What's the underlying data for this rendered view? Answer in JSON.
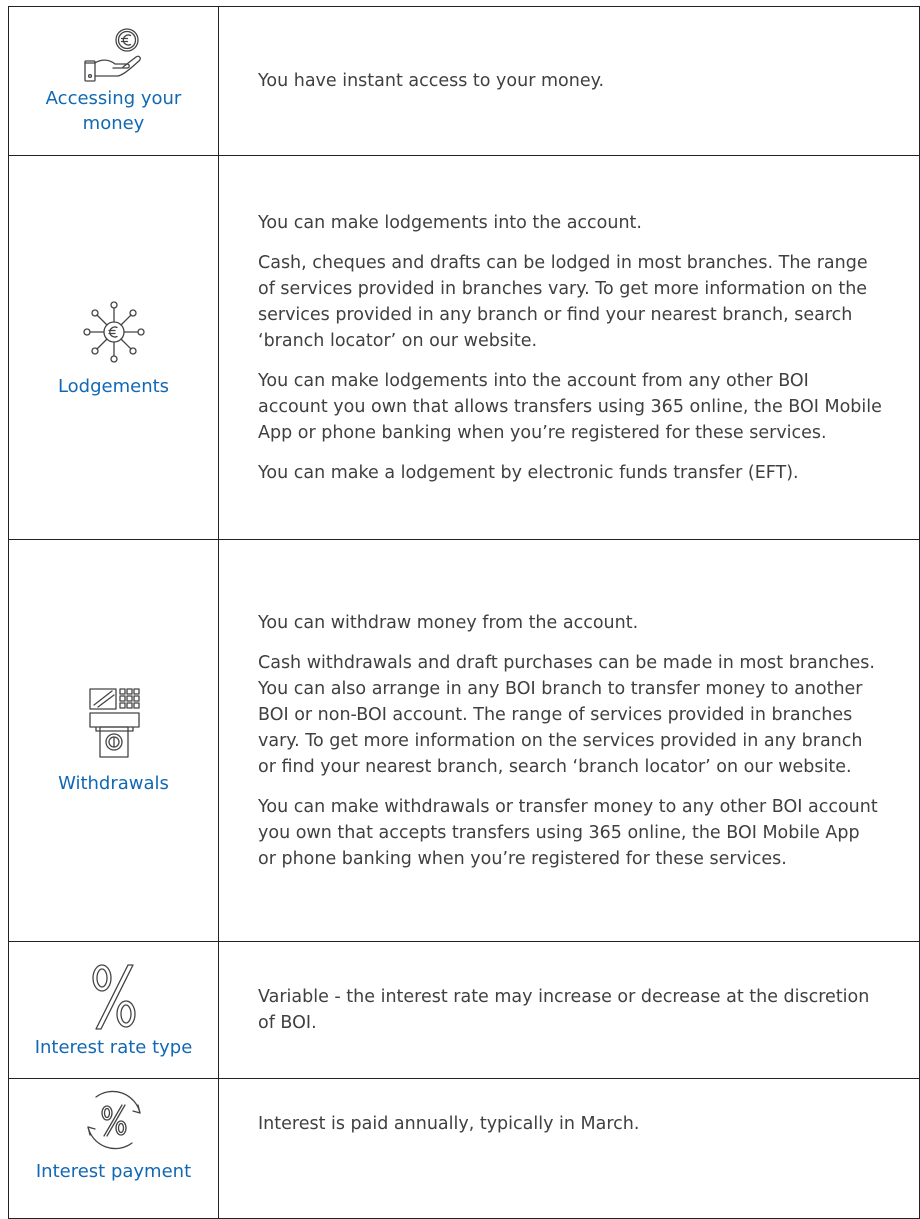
{
  "rows": [
    {
      "label": "Accessing your money",
      "icon": "hand-euro-icon",
      "paragraphs": [
        "You have instant access to your money."
      ]
    },
    {
      "label": "Lodgements",
      "icon": "euro-network-icon",
      "paragraphs": [
        "You can make lodgements into the account.",
        "Cash, cheques and drafts can be lodged in most branches. The range of services provided in branches vary. To get more information on the services provided in any branch or find your nearest branch, search ‘branch locator’ on our website.",
        "You can make lodgements into the account from any other BOI account you own that allows transfers using 365 online, the BOI Mobile App or phone banking when you’re registered for these services.",
        "You can make a lodgement by electronic funds transfer (EFT)."
      ]
    },
    {
      "label": "Withdrawals",
      "icon": "atm-icon",
      "paragraphs": [
        "You can withdraw money from the account.",
        "Cash withdrawals and draft purchases can be made in most branches. You can also arrange in any BOI branch to transfer money to another BOI or non-BOI account. The range of services provided in branches vary. To get more information on the services provided in any branch or find your nearest branch, search ‘branch locator’ on our website.",
        "You can make withdrawals or transfer money to any other BOI account you own that accepts transfers using 365 online, the BOI Mobile App or phone banking when you’re registered for these services."
      ]
    },
    {
      "label": "Interest rate type",
      "icon": "percent-icon",
      "paragraphs": [
        "Variable - the interest rate may increase or decrease at the discretion of BOI."
      ]
    },
    {
      "label": "Interest payment",
      "icon": "percent-cycle-icon",
      "paragraphs": [
        "Interest is paid annually, typically in March."
      ]
    }
  ],
  "colors": {
    "label": "#1268b3",
    "text": "#404040",
    "border": "#222222"
  }
}
